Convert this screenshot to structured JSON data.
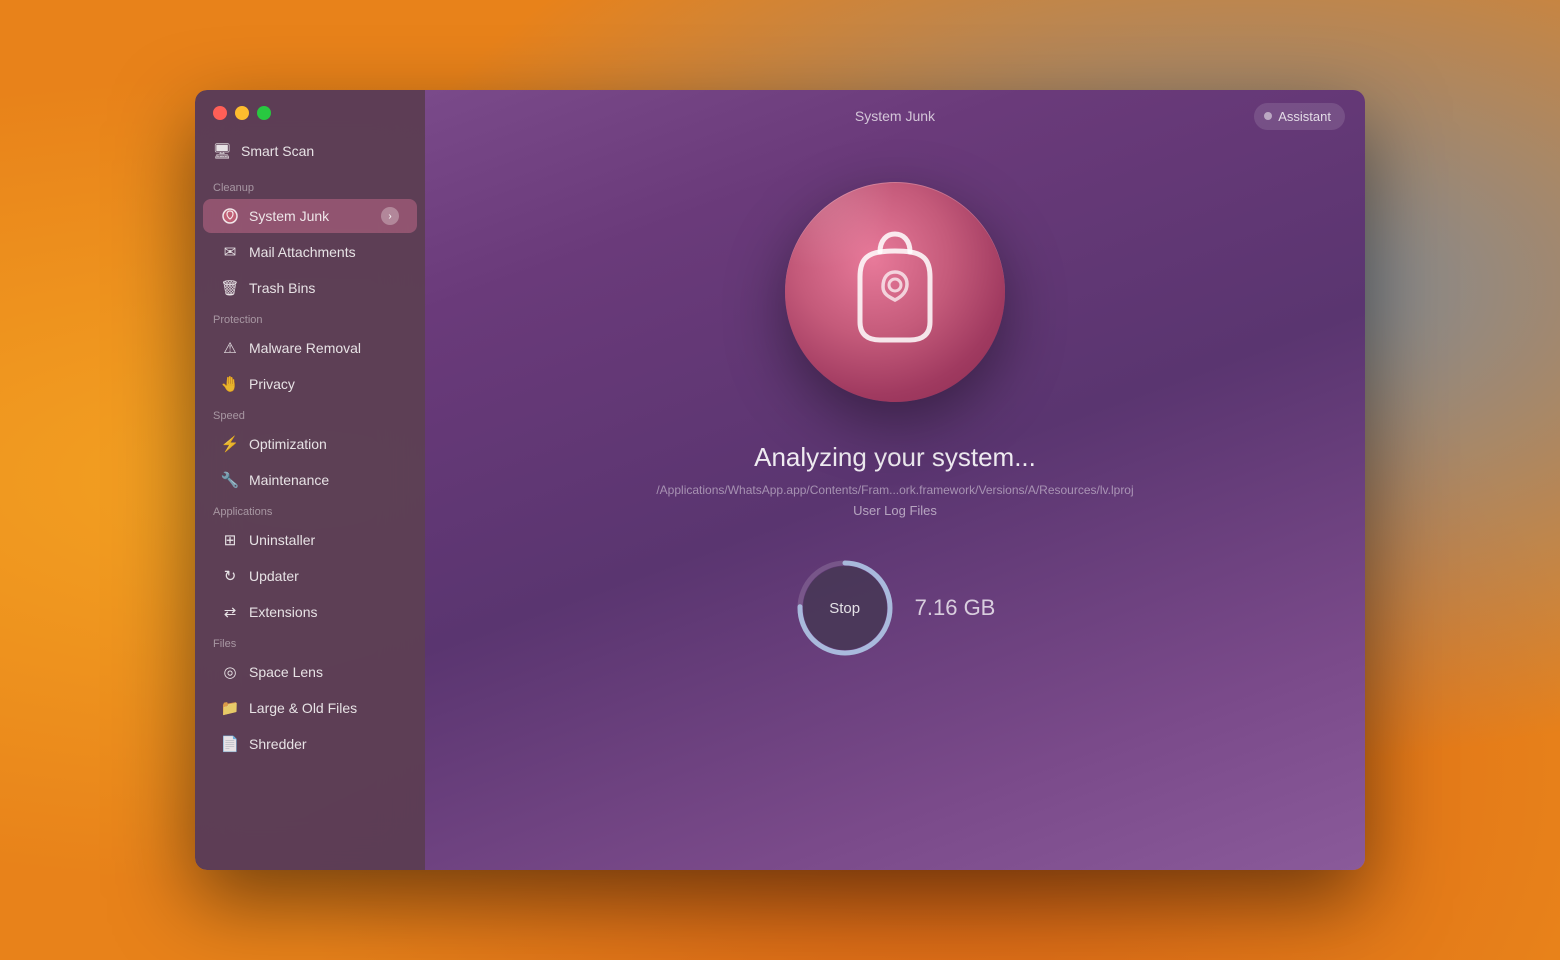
{
  "window": {
    "title": "System Junk",
    "assistant_label": "Assistant"
  },
  "traffic_lights": {
    "close_title": "Close",
    "minimize_title": "Minimize",
    "maximize_title": "Maximize"
  },
  "sidebar": {
    "smart_scan_label": "Smart Scan",
    "sections": [
      {
        "label": "Cleanup",
        "items": [
          {
            "id": "system-junk",
            "label": "System Junk",
            "active": true
          },
          {
            "id": "mail-attachments",
            "label": "Mail Attachments",
            "active": false
          },
          {
            "id": "trash-bins",
            "label": "Trash Bins",
            "active": false
          }
        ]
      },
      {
        "label": "Protection",
        "items": [
          {
            "id": "malware-removal",
            "label": "Malware Removal",
            "active": false
          },
          {
            "id": "privacy",
            "label": "Privacy",
            "active": false
          }
        ]
      },
      {
        "label": "Speed",
        "items": [
          {
            "id": "optimization",
            "label": "Optimization",
            "active": false
          },
          {
            "id": "maintenance",
            "label": "Maintenance",
            "active": false
          }
        ]
      },
      {
        "label": "Applications",
        "items": [
          {
            "id": "uninstaller",
            "label": "Uninstaller",
            "active": false
          },
          {
            "id": "updater",
            "label": "Updater",
            "active": false
          },
          {
            "id": "extensions",
            "label": "Extensions",
            "active": false
          }
        ]
      },
      {
        "label": "Files",
        "items": [
          {
            "id": "space-lens",
            "label": "Space Lens",
            "active": false
          },
          {
            "id": "large-old-files",
            "label": "Large & Old Files",
            "active": false
          },
          {
            "id": "shredder",
            "label": "Shredder",
            "active": false
          }
        ]
      }
    ]
  },
  "main": {
    "analyzing_text": "Analyzing your system...",
    "file_path": "/Applications/WhatsApp.app/Contents/Fram...ork.framework/Versions/A/Resources/lv.lproj",
    "scan_type": "User Log Files",
    "stop_label": "Stop",
    "storage_size": "7.16 GB",
    "progress_percent": 75
  }
}
